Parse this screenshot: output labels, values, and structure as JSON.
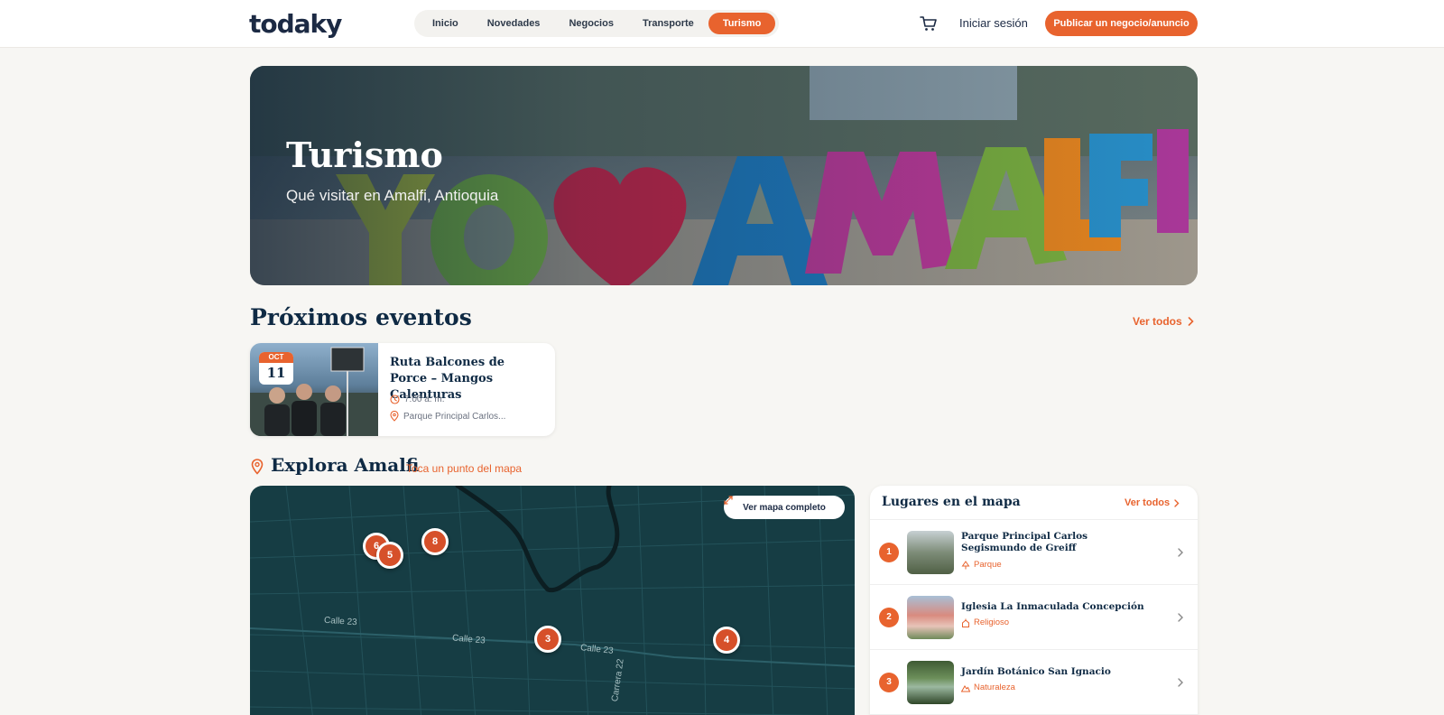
{
  "header": {
    "logo_text": "todaky",
    "nav": [
      "Inicio",
      "Novedades",
      "Negocios",
      "Transporte",
      "Turismo"
    ],
    "active_nav": "Turismo",
    "login_label": "Iniciar sesión",
    "publish_label": "Publicar un negocio/anuncio"
  },
  "hero": {
    "title": "Turismo",
    "subtitle": "Qué visitar en Amalfi, Antioquia",
    "sign_text": "YO ♥ AMALFI"
  },
  "events": {
    "title": "Próximos eventos",
    "see_all": "Ver todos",
    "items": [
      {
        "month": "OCT",
        "day": "11",
        "title": "Ruta Balcones de Porce – Mangos Calenturas",
        "time": "7:00 a. m.",
        "location": "Parque Principal Carlos..."
      }
    ]
  },
  "explore": {
    "title": "Explora Amalfi",
    "hint": "Toca un punto del mapa",
    "map_button": "Ver mapa completo",
    "markers": [
      "6",
      "5",
      "8",
      "3",
      "4"
    ],
    "streets": [
      "Calle 23",
      "Calle 23",
      "Calle 23",
      "Carrera 22"
    ]
  },
  "places": {
    "title": "Lugares en el mapa",
    "see_all": "Ver todos",
    "items": [
      {
        "num": "1",
        "name": "Parque Principal Carlos Segismundo de Greiff",
        "category": "Parque"
      },
      {
        "num": "2",
        "name": "Iglesia La Inmaculada Concepción",
        "category": "Religioso"
      },
      {
        "num": "3",
        "name": "Jardín Botánico San Ignacio",
        "category": "Naturaleza"
      }
    ]
  },
  "colors": {
    "accent": "#e8632e",
    "navy": "#0f2a44",
    "map_bg": "#163d44"
  }
}
